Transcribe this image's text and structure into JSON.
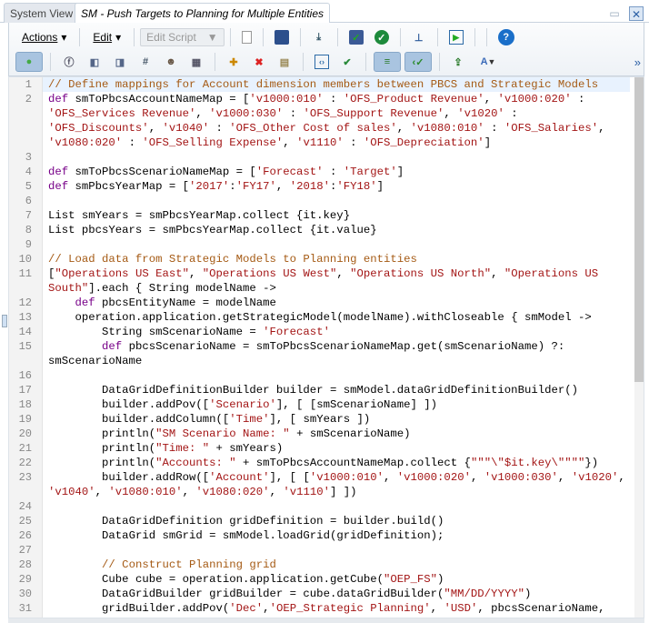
{
  "tabs": {
    "system_view": "System View",
    "active": "SM - Push Targets to Planning for Multiple Entities"
  },
  "toolbar": {
    "actions": "Actions",
    "edit": "Edit",
    "edit_script": "Edit Script",
    "more": "»",
    "row1_icons": [
      "new-document-icon",
      "save-icon",
      "download-icon",
      "save-validate-icon",
      "validate-check-icon",
      "hierarchy-icon",
      "run-script-icon",
      "help-icon"
    ],
    "row2_icons": [
      "line-numbers-toggle-icon",
      "function-icon",
      "member-icon",
      "member-range-icon",
      "variable-icon",
      "smart-list-icon",
      "calculator-icon",
      "add-comment-icon",
      "delete-comment-icon",
      "comment-icon",
      "code-brackets-icon",
      "validate-globe-icon",
      "wrap-text-toggle-icon",
      "syntax-check-toggle-icon",
      "deploy-icon",
      "font-style-icon"
    ]
  },
  "code": {
    "lines": [
      {
        "n": "1",
        "hl": true,
        "t": [
          [
            "c",
            "// Define mappings for Account dimension members between PBCS and Strategic Models"
          ]
        ]
      },
      {
        "n": "2",
        "t": [
          [
            "k",
            "def"
          ],
          [
            "p",
            " smToPbcsAccountNameMap = ["
          ],
          [
            "s",
            "'v1000:010'"
          ],
          [
            "p",
            " : "
          ],
          [
            "s",
            "'OFS_Product Revenue'"
          ],
          [
            "p",
            ", "
          ],
          [
            "s",
            "'v1000:020'"
          ],
          [
            "p",
            " : "
          ],
          [
            "s",
            "'OFS_Services Revenue'"
          ],
          [
            "p",
            ", "
          ],
          [
            "s",
            "'v1000:030'"
          ],
          [
            "p",
            " : "
          ],
          [
            "s",
            "'OFS_Support Revenue'"
          ],
          [
            "p",
            ", "
          ],
          [
            "s",
            "'v1020'"
          ],
          [
            "p",
            " : "
          ],
          [
            "s",
            "'OFS_Discounts'"
          ],
          [
            "p",
            ", "
          ],
          [
            "s",
            "'v1040'"
          ],
          [
            "p",
            " : "
          ],
          [
            "s",
            "'OFS_Other Cost of sales'"
          ],
          [
            "p",
            ", "
          ],
          [
            "s",
            "'v1080:010'"
          ],
          [
            "p",
            " : "
          ],
          [
            "s",
            "'OFS_Salaries'"
          ],
          [
            "p",
            ", "
          ],
          [
            "s",
            "'v1080:020'"
          ],
          [
            "p",
            " : "
          ],
          [
            "s",
            "'OFS_Selling Expense'"
          ],
          [
            "p",
            ", "
          ],
          [
            "s",
            "'v1110'"
          ],
          [
            "p",
            " : "
          ],
          [
            "s",
            "'OFS_Depreciation'"
          ],
          [
            "p",
            "]"
          ]
        ]
      },
      {
        "n": "3",
        "t": []
      },
      {
        "n": "4",
        "t": [
          [
            "k",
            "def"
          ],
          [
            "p",
            " smToPbcsScenarioNameMap = ["
          ],
          [
            "s",
            "'Forecast'"
          ],
          [
            "p",
            " : "
          ],
          [
            "s",
            "'Target'"
          ],
          [
            "p",
            "]"
          ]
        ]
      },
      {
        "n": "5",
        "t": [
          [
            "k",
            "def"
          ],
          [
            "p",
            " smPbcsYearMap = ["
          ],
          [
            "s",
            "'2017'"
          ],
          [
            "p",
            ":"
          ],
          [
            "s",
            "'FY17'"
          ],
          [
            "p",
            ", "
          ],
          [
            "s",
            "'2018'"
          ],
          [
            "p",
            ":"
          ],
          [
            "s",
            "'FY18'"
          ],
          [
            "p",
            "]"
          ]
        ]
      },
      {
        "n": "6",
        "t": []
      },
      {
        "n": "7",
        "t": [
          [
            "p",
            "List smYears = smPbcsYearMap.collect {it.key}"
          ]
        ]
      },
      {
        "n": "8",
        "t": [
          [
            "p",
            "List pbcsYears = smPbcsYearMap.collect {it.value}"
          ]
        ]
      },
      {
        "n": "9",
        "t": []
      },
      {
        "n": "10",
        "t": [
          [
            "c",
            "// Load data from Strategic Models to Planning entities"
          ]
        ]
      },
      {
        "n": "11",
        "t": [
          [
            "p",
            "["
          ],
          [
            "s",
            "\"Operations US East\""
          ],
          [
            "p",
            ", "
          ],
          [
            "s",
            "\"Operations US West\""
          ],
          [
            "p",
            ", "
          ],
          [
            "s",
            "\"Operations US North\""
          ],
          [
            "p",
            ", "
          ],
          [
            "s",
            "\"Operations US South\""
          ],
          [
            "p",
            "].each { String modelName ->"
          ]
        ]
      },
      {
        "n": "12",
        "t": [
          [
            "p",
            "    "
          ],
          [
            "k",
            "def"
          ],
          [
            "p",
            " pbcsEntityName = modelName"
          ]
        ]
      },
      {
        "n": "13",
        "t": [
          [
            "p",
            "    operation.application.getStrategicModel(modelName).withCloseable { smModel ->"
          ]
        ]
      },
      {
        "n": "14",
        "t": [
          [
            "p",
            "        String smScenarioName = "
          ],
          [
            "s",
            "'Forecast'"
          ]
        ]
      },
      {
        "n": "15",
        "t": [
          [
            "p",
            "        "
          ],
          [
            "k",
            "def"
          ],
          [
            "p",
            " pbcsScenarioName = smToPbcsScenarioNameMap.get(smScenarioName) ?: smScenarioName"
          ]
        ]
      },
      {
        "n": "16",
        "t": []
      },
      {
        "n": "17",
        "t": [
          [
            "p",
            "        DataGridDefinitionBuilder builder = smModel.dataGridDefinitionBuilder()"
          ]
        ]
      },
      {
        "n": "18",
        "t": [
          [
            "p",
            "        builder.addPov(["
          ],
          [
            "s",
            "'Scenario'"
          ],
          [
            "p",
            "], [ [smScenarioName] ])"
          ]
        ]
      },
      {
        "n": "19",
        "t": [
          [
            "p",
            "        builder.addColumn(["
          ],
          [
            "s",
            "'Time'"
          ],
          [
            "p",
            "], [ smYears ])"
          ]
        ]
      },
      {
        "n": "20",
        "t": [
          [
            "p",
            "        println("
          ],
          [
            "s",
            "\"SM Scenario Name: \""
          ],
          [
            "p",
            " + smScenarioName)"
          ]
        ]
      },
      {
        "n": "21",
        "t": [
          [
            "p",
            "        println("
          ],
          [
            "s",
            "\"Time: \""
          ],
          [
            "p",
            " + smYears)"
          ]
        ]
      },
      {
        "n": "22",
        "t": [
          [
            "p",
            "        println("
          ],
          [
            "s",
            "\"Accounts: \""
          ],
          [
            "p",
            " + smToPbcsAccountNameMap.collect {"
          ],
          [
            "s",
            "\"\"\"\\\"$it.key\\\"\"\"\""
          ],
          [
            "p",
            "})"
          ]
        ]
      },
      {
        "n": "23",
        "t": [
          [
            "p",
            "        builder.addRow(["
          ],
          [
            "s",
            "'Account'"
          ],
          [
            "p",
            "], [ ["
          ],
          [
            "s",
            "'v1000:010'"
          ],
          [
            "p",
            ", "
          ],
          [
            "s",
            "'v1000:020'"
          ],
          [
            "p",
            ", "
          ],
          [
            "s",
            "'v1000:030'"
          ],
          [
            "p",
            ", "
          ],
          [
            "s",
            "'v1020'"
          ],
          [
            "p",
            ", "
          ],
          [
            "s",
            "'v1040'"
          ],
          [
            "p",
            ", "
          ],
          [
            "s",
            "'v1080:010'"
          ],
          [
            "p",
            ", "
          ],
          [
            "s",
            "'v1080:020'"
          ],
          [
            "p",
            ", "
          ],
          [
            "s",
            "'v1110'"
          ],
          [
            "p",
            "] ])"
          ]
        ]
      },
      {
        "n": "24",
        "t": []
      },
      {
        "n": "25",
        "t": [
          [
            "p",
            "        DataGridDefinition gridDefinition = builder.build()"
          ]
        ]
      },
      {
        "n": "26",
        "t": [
          [
            "p",
            "        DataGrid smGrid = smModel.loadGrid(gridDefinition);"
          ]
        ]
      },
      {
        "n": "27",
        "t": []
      },
      {
        "n": "28",
        "t": [
          [
            "p",
            "        "
          ],
          [
            "c",
            "// Construct Planning grid"
          ]
        ]
      },
      {
        "n": "29",
        "t": [
          [
            "p",
            "        Cube cube = operation.application.getCube("
          ],
          [
            "s",
            "\"OEP_FS\""
          ],
          [
            "p",
            ")"
          ]
        ]
      },
      {
        "n": "30",
        "t": [
          [
            "p",
            "        DataGridBuilder gridBuilder = cube.dataGridBuilder("
          ],
          [
            "s",
            "\"MM/DD/YYYY\""
          ],
          [
            "p",
            ")"
          ]
        ]
      },
      {
        "n": "31",
        "t": [
          [
            "p",
            "        gridBuilder.addPov("
          ],
          [
            "s",
            "'Dec'"
          ],
          [
            "p",
            ","
          ],
          [
            "s",
            "'OEP_Strategic Planning'"
          ],
          [
            "p",
            ", "
          ],
          [
            "s",
            "'USD'"
          ],
          [
            "p",
            ", pbcsScenarioName,"
          ]
        ]
      }
    ]
  }
}
